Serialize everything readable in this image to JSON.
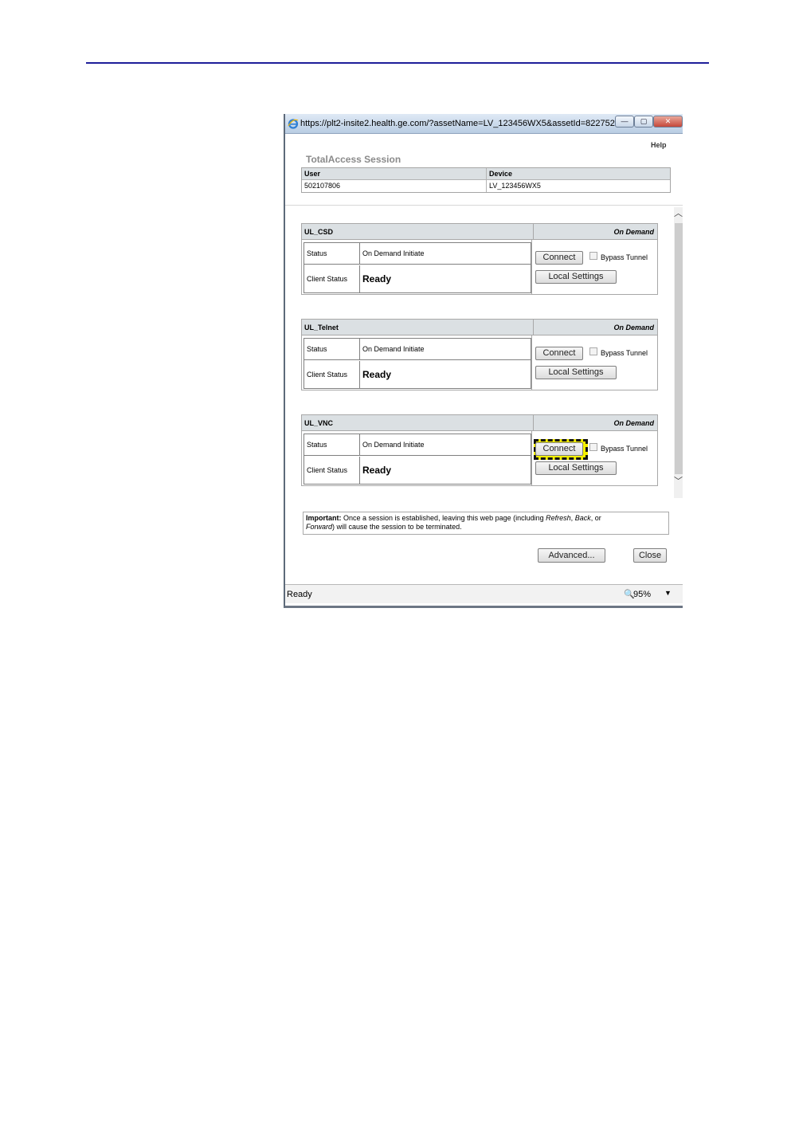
{
  "window": {
    "url": "https://plt2-insite2.health.ge.com/?assetName=LV_123456WX5&assetId=822752...",
    "help": "Help",
    "session_title": "TotalAccess Session"
  },
  "info": {
    "user_header": "User",
    "device_header": "Device",
    "user_value": "502107806",
    "device_value": "LV_123456WX5"
  },
  "services": [
    {
      "name": "UL_CSD",
      "mode": "On Demand",
      "status_label": "Status",
      "status_value": "On Demand Initiate",
      "client_label": "Client Status",
      "client_value": "Ready",
      "connect": "Connect",
      "bypass": "Bypass Tunnel",
      "local": "Local Settings"
    },
    {
      "name": "UL_Telnet",
      "mode": "On Demand",
      "status_label": "Status",
      "status_value": "On Demand Initiate",
      "client_label": "Client Status",
      "client_value": "Ready",
      "connect": "Connect",
      "bypass": "Bypass Tunnel",
      "local": "Local Settings"
    },
    {
      "name": "UL_VNC",
      "mode": "On Demand",
      "status_label": "Status",
      "status_value": "On Demand Initiate",
      "client_label": "Client Status",
      "client_value": "Ready",
      "connect": "Connect",
      "bypass": "Bypass Tunnel",
      "local": "Local Settings"
    }
  ],
  "notice": {
    "important": "Important:",
    "text1": " Once a session is established, leaving this web page (including ",
    "refresh": "Refresh",
    "comma": ", ",
    "back": "Back",
    "or": ", or",
    "forward": "Forward",
    "text2": ") will cause the session to be terminated."
  },
  "footer": {
    "advanced": "Advanced...",
    "close": "Close"
  },
  "statusbar": {
    "status": "Ready",
    "zoom": "95%",
    "zoom_icon": "magnifier-icon",
    "dropdown_icon": "chevron-down-icon"
  },
  "colors": {
    "highlight": "#f4ef00",
    "title_rule": "#1f1f9a"
  }
}
